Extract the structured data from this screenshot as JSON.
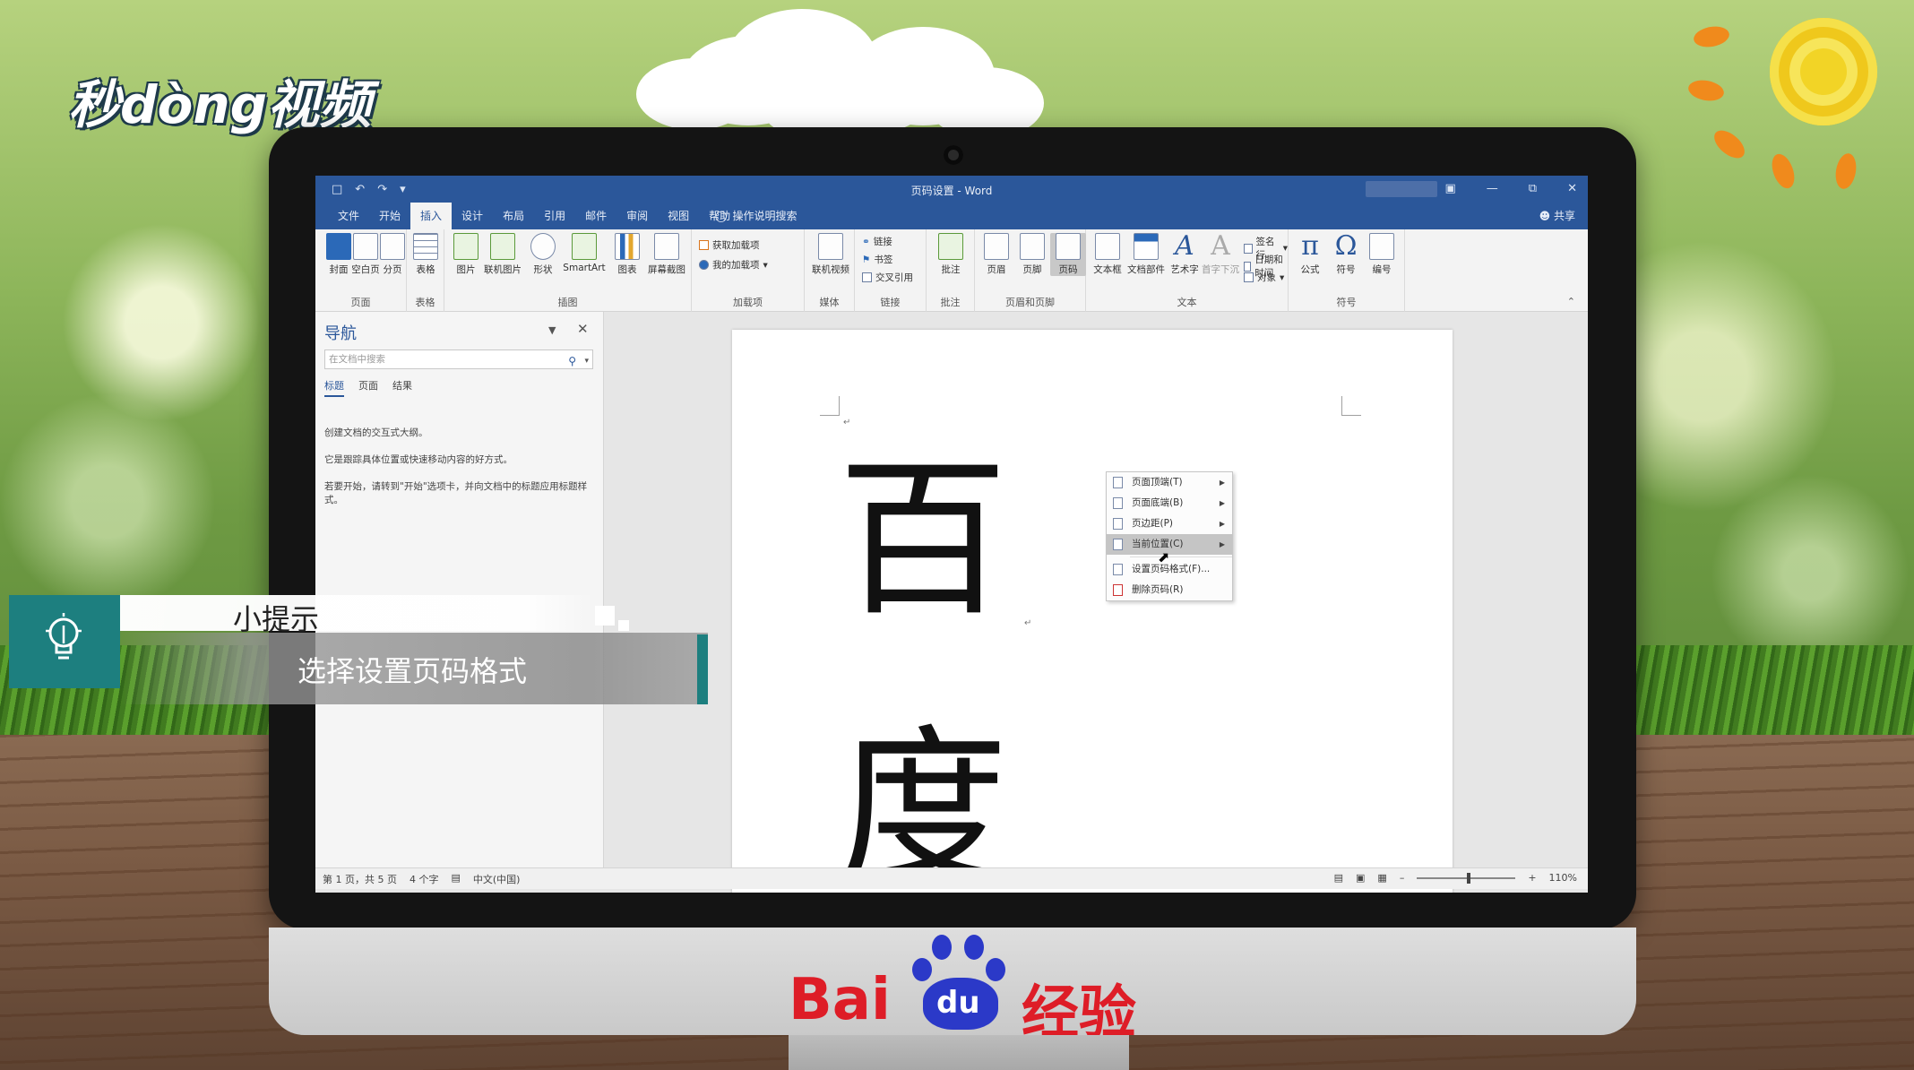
{
  "brand": {
    "logo_text": "秒dòng视频"
  },
  "window": {
    "title": "页码设置 - Word",
    "qat": [
      "□",
      "↶",
      "↷",
      "▾"
    ],
    "controls": [
      "▣",
      "—",
      "⧉",
      "✕"
    ]
  },
  "tabs": [
    "文件",
    "开始",
    "插入",
    "设计",
    "布局",
    "引用",
    "邮件",
    "审阅",
    "视图",
    "帮助"
  ],
  "active_tab": "插入",
  "tell_me": "操作说明搜索",
  "share": "共享",
  "ribbon": {
    "groups": {
      "pages": "页面",
      "tables": "表格",
      "illustrations": "插图",
      "addins": "加载项",
      "media": "媒体",
      "links": "链接",
      "comments": "批注",
      "header_footer": "页眉和页脚",
      "text": "文本",
      "symbols": "符号"
    },
    "buttons": {
      "cover": "封面",
      "blank": "空白页",
      "break": "分页",
      "table": "表格",
      "picture": "图片",
      "online_picture": "联机图片",
      "shapes": "形状",
      "smartart": "SmartArt",
      "chart": "图表",
      "screenshot": "屏幕截图",
      "get_addins": "获取加载项",
      "my_addins": "我的加载项",
      "online_video": "联机视频",
      "link": "链接",
      "bookmark": "书签",
      "cross_ref": "交叉引用",
      "comment": "批注",
      "header": "页眉",
      "footer": "页脚",
      "page_number": "页码",
      "textbox": "文本框",
      "quick_parts": "文档部件",
      "wordart": "艺术字",
      "dropcap": "首字下沉",
      "signature": "签名行",
      "datetime": "日期和时间",
      "object": "对象",
      "equation": "公式",
      "symbol": "符号",
      "number": "编号"
    }
  },
  "nav": {
    "title": "导航",
    "search_placeholder": "在文档中搜索",
    "tabs": [
      "标题",
      "页面",
      "结果"
    ],
    "text1": "创建文档的交互式大纲。",
    "text2": "它是跟踪具体位置或快速移动内容的好方式。",
    "text3": "若要开始，请转到\"开始\"选项卡，并向文档中的标题应用标题样式。"
  },
  "document": {
    "char1": "百",
    "char2": "度",
    "para_mark": "↵"
  },
  "page_number_menu": {
    "items": [
      "页面顶端(T)",
      "页面底端(B)",
      "页边距(P)",
      "当前位置(C)",
      "设置页码格式(F)...",
      "删除页码(R)"
    ]
  },
  "status": {
    "page": "第 1 页，共 5 页",
    "words": "4 个字",
    "language": "中文(中国)",
    "zoom": "110%"
  },
  "tip": {
    "title": "小提示",
    "body": "选择设置页码格式"
  },
  "baidu": {
    "bai": "Bai",
    "du": "du",
    "jingyan": "经验"
  },
  "colors": {
    "word_blue": "#2b579a",
    "teal": "#1d7f7f",
    "baidu_red": "#de1d27",
    "baidu_blue": "#2b39c8"
  }
}
